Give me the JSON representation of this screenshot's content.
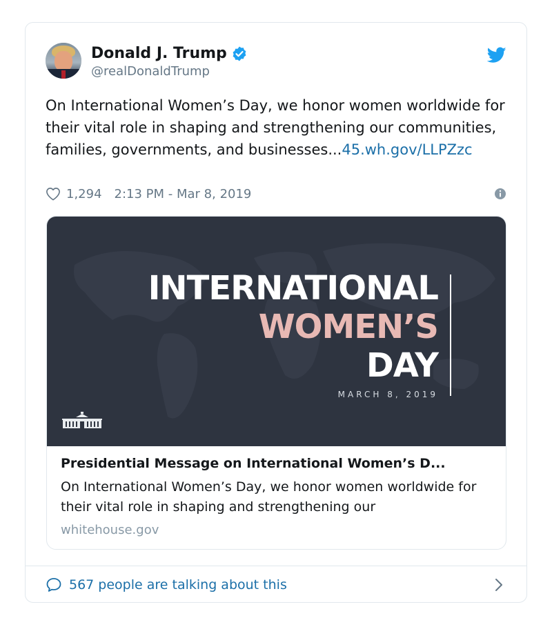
{
  "author": {
    "name": "Donald J. Trump",
    "handle": "@realDonaldTrump",
    "verified": true
  },
  "tweet": {
    "text": "On International Women’s Day, we honor women worldwide for their vital role in shaping and strengthening our communities, families, governments, and businesses...",
    "link_text": "45.wh.gov/LLPZzc",
    "likes": "1,294",
    "timestamp": "2:13 PM - Mar 8, 2019"
  },
  "link_card": {
    "banner": {
      "line1": "INTERNATIONAL",
      "line2": "WOMEN’S",
      "line3": "DAY",
      "date": "MARCH 8, 2019"
    },
    "title": "Presidential Message on International Women’s D...",
    "description": "On International Women’s Day, we honor women worldwide for their vital role in shaping and strengthening our",
    "domain": "whitehouse.gov"
  },
  "footer": {
    "talking_text": "567 people are talking about this"
  },
  "icons": {
    "bird": "twitter-bird-icon",
    "verified": "verified-badge-icon",
    "heart": "heart-icon",
    "info": "info-icon",
    "bubble": "speech-bubble-icon",
    "chevron": "chevron-right-icon",
    "whitehouse": "white-house-icon"
  },
  "colors": {
    "brand_blue": "#1da1f2",
    "link_blue": "#1b6fa8",
    "secondary_text": "#657786",
    "banner_bg": "#2e3440",
    "banner_pink": "#e8b9b4"
  }
}
